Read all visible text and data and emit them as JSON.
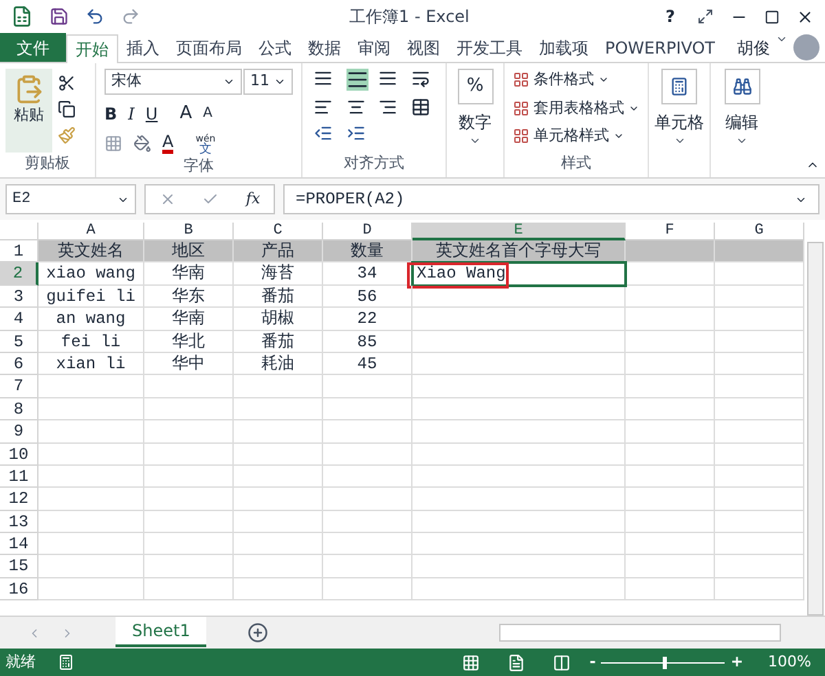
{
  "title": "工作簿1 - Excel",
  "help": "?",
  "ribbon_tabs": [
    {
      "label": "文件",
      "kind": "file",
      "selected": false
    },
    {
      "label": "开始",
      "kind": "tab",
      "selected": true
    },
    {
      "label": "插入",
      "kind": "tab",
      "selected": false
    },
    {
      "label": "页面布局",
      "kind": "tab",
      "selected": false
    },
    {
      "label": "公式",
      "kind": "tab",
      "selected": false
    },
    {
      "label": "数据",
      "kind": "tab",
      "selected": false
    },
    {
      "label": "审阅",
      "kind": "tab",
      "selected": false
    },
    {
      "label": "视图",
      "kind": "tab",
      "selected": false
    },
    {
      "label": "开发工具",
      "kind": "tab",
      "selected": false
    },
    {
      "label": "加载项",
      "kind": "tab",
      "selected": false
    },
    {
      "label": "POWERPIVOT",
      "kind": "tab",
      "selected": false
    }
  ],
  "user": {
    "name": "胡俊"
  },
  "clipboard": {
    "paste": "粘贴",
    "label": "剪贴板"
  },
  "font": {
    "name": "宋体",
    "size": "11",
    "bold": "B",
    "italic": "I",
    "underline": "U",
    "grow": "A",
    "shrink": "A",
    "color_letter": "A",
    "phonetic_top": "wén",
    "phonetic_bottom": "文",
    "label": "字体"
  },
  "alignment": {
    "label": "对齐方式",
    "middle_selected": true
  },
  "number": {
    "symbol": "%",
    "label": "数字"
  },
  "styles": {
    "items": [
      "条件格式",
      "套用表格格式",
      "单元格样式"
    ],
    "label": "样式"
  },
  "cells_group": {
    "label": "单元格"
  },
  "editing": {
    "label": "编辑"
  },
  "name_box": "E2",
  "fx": "fx",
  "formula": "=PROPER(A2)",
  "columns": [
    {
      "label": "A",
      "selected": false
    },
    {
      "label": "B",
      "selected": false
    },
    {
      "label": "C",
      "selected": false
    },
    {
      "label": "D",
      "selected": false
    },
    {
      "label": "E",
      "selected": true
    },
    {
      "label": "F",
      "selected": false
    },
    {
      "label": "G",
      "selected": false
    }
  ],
  "rows": [
    {
      "number": "1",
      "kind": "header",
      "selected": false,
      "cells": [
        {
          "text": "英文姓名",
          "active": false,
          "marked": false
        },
        {
          "text": "地区",
          "active": false,
          "marked": false
        },
        {
          "text": "产品",
          "active": false,
          "marked": false
        },
        {
          "text": "数量",
          "active": false,
          "marked": false
        },
        {
          "text": "英文姓名首个字母大写",
          "active": false,
          "marked": false
        }
      ]
    },
    {
      "number": "2",
      "kind": "data",
      "selected": true,
      "cells": [
        {
          "text": "xiao wang",
          "active": false,
          "marked": false
        },
        {
          "text": "华南",
          "active": false,
          "marked": false
        },
        {
          "text": "海苔",
          "active": false,
          "marked": false
        },
        {
          "text": "34",
          "active": false,
          "marked": false
        },
        {
          "text": "Xiao Wang",
          "active": true,
          "marked": true
        }
      ]
    },
    {
      "number": "3",
      "kind": "data",
      "selected": false,
      "cells": [
        {
          "text": "guifei li",
          "active": false,
          "marked": false
        },
        {
          "text": "华东",
          "active": false,
          "marked": false
        },
        {
          "text": "番茄",
          "active": false,
          "marked": false
        },
        {
          "text": "56",
          "active": false,
          "marked": false
        }
      ]
    },
    {
      "number": "4",
      "kind": "data",
      "selected": false,
      "cells": [
        {
          "text": "an wang",
          "active": false,
          "marked": false
        },
        {
          "text": "华南",
          "active": false,
          "marked": false
        },
        {
          "text": "胡椒",
          "active": false,
          "marked": false
        },
        {
          "text": "22",
          "active": false,
          "marked": false
        }
      ]
    },
    {
      "number": "5",
      "kind": "data",
      "selected": false,
      "cells": [
        {
          "text": "fei li",
          "active": false,
          "marked": false
        },
        {
          "text": "华北",
          "active": false,
          "marked": false
        },
        {
          "text": "番茄",
          "active": false,
          "marked": false
        },
        {
          "text": "85",
          "active": false,
          "marked": false
        }
      ]
    },
    {
      "number": "6",
      "kind": "data",
      "selected": false,
      "cells": [
        {
          "text": "xian li",
          "active": false,
          "marked": false
        },
        {
          "text": "华中",
          "active": false,
          "marked": false
        },
        {
          "text": "耗油",
          "active": false,
          "marked": false
        },
        {
          "text": "45",
          "active": false,
          "marked": false
        }
      ]
    },
    {
      "number": "7",
      "kind": "data",
      "selected": false,
      "cells": []
    },
    {
      "number": "8",
      "kind": "data",
      "selected": false,
      "cells": []
    },
    {
      "number": "9",
      "kind": "data",
      "selected": false,
      "cells": []
    },
    {
      "number": "10",
      "kind": "data",
      "selected": false,
      "cells": []
    },
    {
      "number": "11",
      "kind": "data",
      "selected": false,
      "cells": []
    },
    {
      "number": "12",
      "kind": "data",
      "selected": false,
      "cells": []
    },
    {
      "number": "13",
      "kind": "data",
      "selected": false,
      "cells": []
    },
    {
      "number": "14",
      "kind": "data",
      "selected": false,
      "cells": []
    },
    {
      "number": "15",
      "kind": "data",
      "selected": false,
      "cells": []
    },
    {
      "number": "16",
      "kind": "data",
      "selected": false,
      "cells": []
    }
  ],
  "sheets": [
    {
      "label": "Sheet1",
      "selected": true
    }
  ],
  "status": "就绪",
  "zoom": {
    "minus": "-",
    "plus": "+",
    "level": 0.5,
    "text": "100%"
  }
}
